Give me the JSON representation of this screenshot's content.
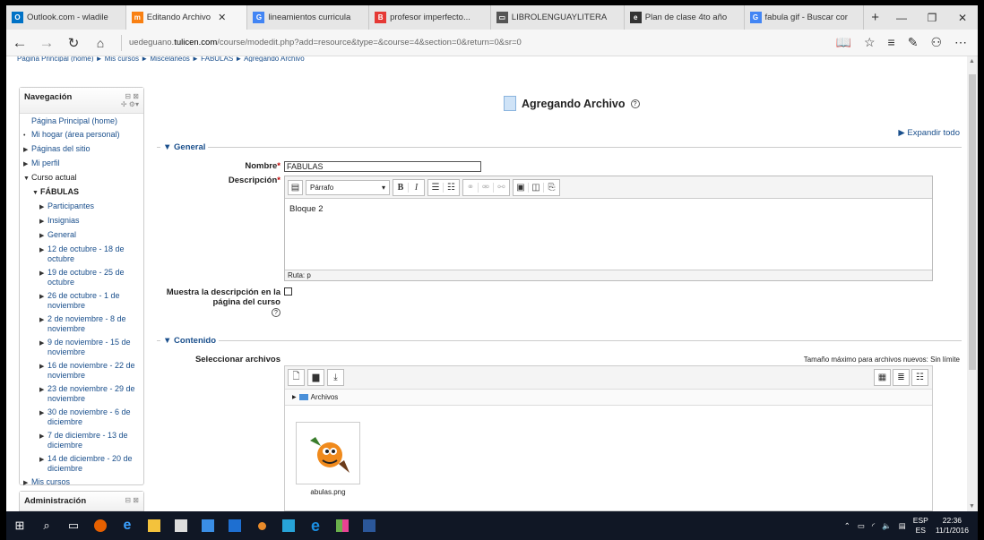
{
  "browser": {
    "tabs": [
      {
        "label": "Outlook.com - wladile",
        "icon": "outlook-icon",
        "color": "#0072c6",
        "glyph": "O"
      },
      {
        "label": "Editando Archivo",
        "icon": "moodle-icon",
        "color": "#f98012",
        "glyph": "m",
        "active": true,
        "close": "✕"
      },
      {
        "label": "lineamientos curricula",
        "icon": "google-icon",
        "color": "#4285f4",
        "glyph": "G"
      },
      {
        "label": "profesor imperfecto...",
        "icon": "blogger-icon",
        "color": "#e53935",
        "glyph": "B"
      },
      {
        "label": "LIBROLENGUAYLITERA",
        "icon": "reading-icon",
        "color": "#555555",
        "glyph": "▭"
      },
      {
        "label": "Plan de clase 4to año",
        "icon": "document-icon",
        "color": "#333333",
        "glyph": "e"
      },
      {
        "label": "fabula gif - Buscar cor",
        "icon": "google-icon",
        "color": "#4285f4",
        "glyph": "G"
      }
    ],
    "new_tab": "+",
    "window_controls": {
      "minimize": "—",
      "maximize": "❐",
      "close": "✕"
    },
    "url_prefix": "uedeguano.",
    "url_domain": "tulicen.com",
    "url_path": "/course/modedit.php?add=resource&type=&course=4&section=0&return=0&sr=0"
  },
  "breadcrumb": "Página Principal (home) ► Mis cursos ► Misceláneos ► FABULAS ► Agregando Archivo",
  "sidebar": {
    "nav_title": "Navegación",
    "nav_ctrls": "⊟ ⊠",
    "nav_ctrls2": "✢ ⚙▾",
    "items": [
      {
        "label": "Página Principal (home)",
        "level": 1,
        "marker": ""
      },
      {
        "label": "Mi hogar (área personal)",
        "level": 1,
        "marker": "•"
      },
      {
        "label": "Páginas del sitio",
        "level": 1,
        "marker": "▶"
      },
      {
        "label": "Mi perfil",
        "level": 1,
        "marker": "▶"
      },
      {
        "label": "Curso actual",
        "level": 1,
        "marker": "▼"
      },
      {
        "label": "FÁBULAS",
        "level": 2,
        "marker": "▼"
      },
      {
        "label": "Participantes",
        "level": 3,
        "marker": "▶"
      },
      {
        "label": "Insignias",
        "level": 3,
        "marker": "▶"
      },
      {
        "label": "General",
        "level": 3,
        "marker": "▶"
      },
      {
        "label": "12 de octubre - 18 de octubre",
        "level": 3,
        "marker": "▶"
      },
      {
        "label": "19 de octubre - 25 de octubre",
        "level": 3,
        "marker": "▶"
      },
      {
        "label": "26 de octubre - 1 de noviembre",
        "level": 3,
        "marker": "▶"
      },
      {
        "label": "2 de noviembre - 8 de noviembre",
        "level": 3,
        "marker": "▶"
      },
      {
        "label": "9 de noviembre - 15 de noviembre",
        "level": 3,
        "marker": "▶"
      },
      {
        "label": "16 de noviembre - 22 de noviembre",
        "level": 3,
        "marker": "▶"
      },
      {
        "label": "23 de noviembre - 29 de noviembre",
        "level": 3,
        "marker": "▶"
      },
      {
        "label": "30 de noviembre - 6 de diciembre",
        "level": 3,
        "marker": "▶"
      },
      {
        "label": "7 de diciembre - 13 de diciembre",
        "level": 3,
        "marker": "▶"
      },
      {
        "label": "14 de diciembre - 20 de diciembre",
        "level": 3,
        "marker": "▶"
      },
      {
        "label": "Mis cursos",
        "level": 1,
        "marker": "▶"
      }
    ],
    "admin_title": "Administración"
  },
  "main": {
    "title": "Agregando Archivo",
    "expand_all": "Expandir todo",
    "general_legend": "General",
    "name_label": "Nombre",
    "name_value": "FABULAS",
    "desc_label": "Descripción",
    "paragraph_select": "Párrafo",
    "editor_text": "Bloque 2",
    "editor_path": "Ruta: p",
    "show_desc_label": "Muestra la descripción en la página del curso",
    "content_legend": "Contenido",
    "select_files_label": "Seleccionar archivos",
    "max_size": "Tamaño máximo para archivos nuevos: Sin límite",
    "folder_label": "Archivos",
    "file_name": "abulas.png"
  },
  "taskbar": {
    "lang1": "ESP",
    "lang2": "ES",
    "time": "22:36",
    "date": "11/1/2016"
  }
}
